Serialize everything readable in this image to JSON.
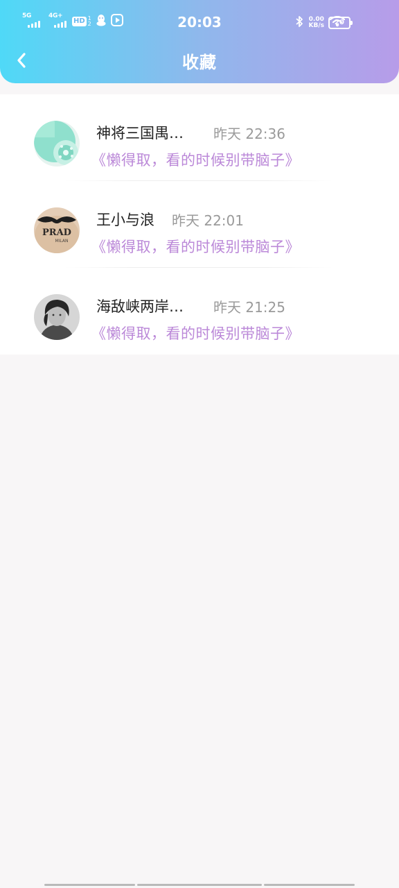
{
  "status_bar": {
    "network_1": "5G",
    "network_2": "4G+",
    "hd_badge": "HD",
    "hd_fraction_top": "1",
    "hd_fraction_bottom": "2",
    "time": "20:03",
    "speed_value": "0.00",
    "speed_unit": "KB/s",
    "battery_level": "20",
    "icons": [
      "signal-icon",
      "qq-icon",
      "video-play-icon",
      "bluetooth-icon",
      "wifi-icon",
      "battery-icon"
    ]
  },
  "header": {
    "back_icon": "chevron-left-icon",
    "title": "收藏"
  },
  "favorites": [
    {
      "name": "神将三国禺…",
      "time": "昨天 22:36",
      "title": "《懒得取，看的时候别带脑子》",
      "avatar": "mint-rotary-phone"
    },
    {
      "name": "王小与浪",
      "time": "昨天 22:01",
      "title": "《懒得取，看的时候别带脑子》",
      "avatar": "prada-mustache"
    },
    {
      "name": "海敌峡两岸…",
      "time": "昨天 21:25",
      "title": "《懒得取，看的时候别带脑子》",
      "avatar": "bw-portrait"
    }
  ],
  "colors": {
    "header_gradient_start": "#4fd9f7",
    "header_gradient_end": "#b79ce9",
    "accent_title": "#bb88d8",
    "background": "#f8f6f7"
  }
}
